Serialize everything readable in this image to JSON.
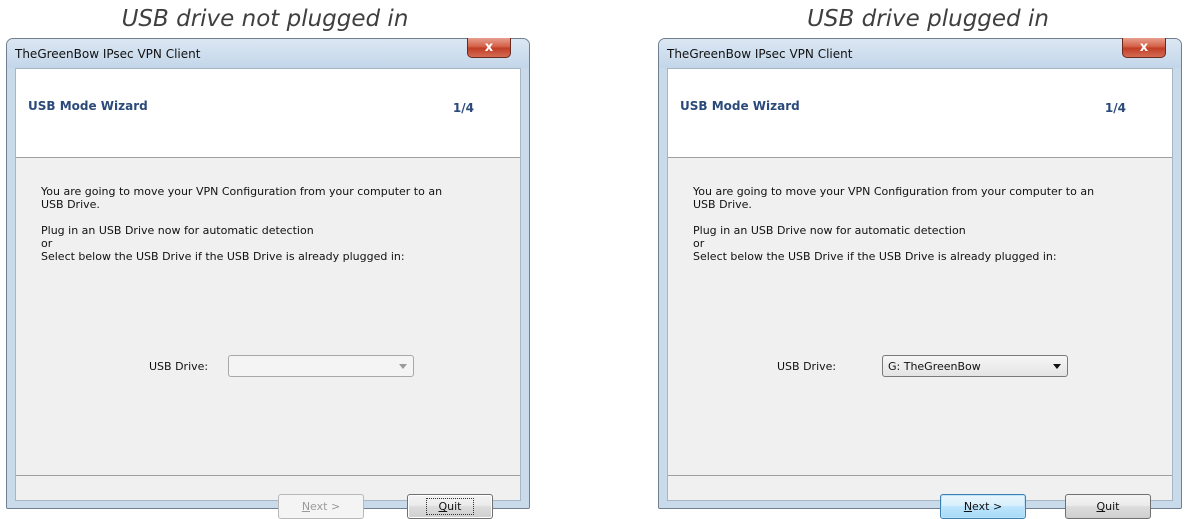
{
  "captions": {
    "left": "USB drive not plugged in",
    "right": "USB drive plugged in"
  },
  "left_dialog": {
    "window_title": "TheGreenBow IPsec VPN Client",
    "close_glyph": "x",
    "wizard_title": "USB Mode Wizard",
    "step": "1/4",
    "text_line1": "You are going to move your VPN Configuration from your computer to an",
    "text_line2": "USB Drive.",
    "text_line3": "Plug in an USB Drive now for automatic detection",
    "text_line4": "or",
    "text_line5": "Select below the USB Drive if the USB Drive is already plugged in:",
    "usb_label": "USB Drive:",
    "usb_value": "",
    "next_label": "Next >",
    "next_enabled": false,
    "quit_label": "Quit"
  },
  "right_dialog": {
    "window_title": "TheGreenBow IPsec VPN Client",
    "close_glyph": "x",
    "wizard_title": "USB Mode Wizard",
    "step": "1/4",
    "text_line1": "You are going to move your VPN Configuration from your computer to an",
    "text_line2": "USB Drive.",
    "text_line3": "Plug in an USB Drive now for automatic detection",
    "text_line4": "or",
    "text_line5": "Select below the USB Drive if the USB Drive is already plugged in:",
    "usb_label": "USB Drive:",
    "usb_value": "G: TheGreenBow",
    "next_label": "Next >",
    "next_enabled": true,
    "quit_label": "Quit"
  }
}
